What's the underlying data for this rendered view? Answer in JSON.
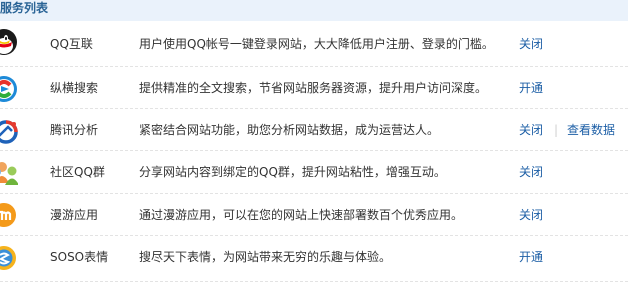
{
  "header": {
    "title": "服务列表"
  },
  "services": [
    {
      "icon": "qq-penguin-icon",
      "name": "QQ互联",
      "description": "用户使用QQ帐号一键登录网站，大大降低用户注册、登录的门槛。",
      "action": "关闭"
    },
    {
      "icon": "soso-search-icon",
      "name": "纵横搜索",
      "description": "提供精准的全文搜索，节省网站服务器资源，提升用户访问深度。",
      "action": "开通"
    },
    {
      "icon": "analytics-icon",
      "name": "腾讯分析",
      "description": "紧密结合网站功能，助您分析网站数据，成为运营达人。",
      "action": "关闭",
      "extra": "查看数据"
    },
    {
      "icon": "group-users-icon",
      "name": "社区QQ群",
      "description": "分享网站内容到绑定的QQ群，提升网站粘性，增强互动。",
      "action": "关闭"
    },
    {
      "icon": "manyou-apps-icon",
      "name": "漫游应用",
      "description": "通过漫游应用，可以在您的网站上快速部署数百个优秀应用。",
      "action": "关闭"
    },
    {
      "icon": "soso-emoji-icon",
      "name": "SOSO表情",
      "description": "搜尽天下表情，为网站带来无穷的乐趣与体验。",
      "action": "开通"
    }
  ]
}
